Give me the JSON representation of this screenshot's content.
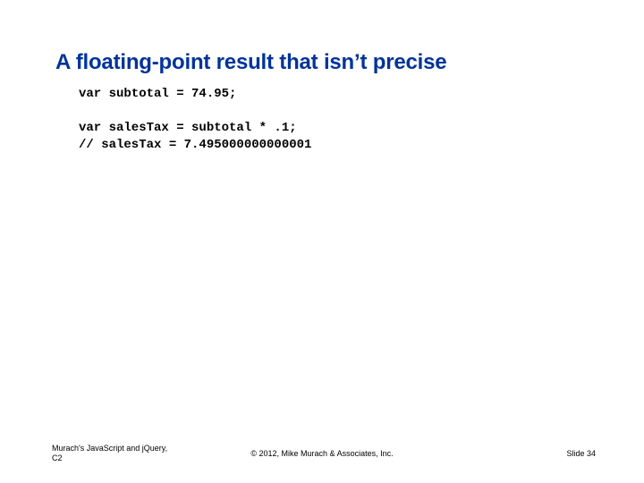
{
  "title": "A floating-point result that isn’t precise",
  "code": {
    "line1": "var subtotal = 74.95;",
    "blank1": "",
    "line2": "var salesTax = subtotal * .1;",
    "line3": "// salesTax = 7.495000000000001"
  },
  "footer": {
    "left_line1": "Murach's JavaScript and jQuery,",
    "left_line2": "C2",
    "center": "© 2012, Mike Murach & Associates, Inc.",
    "right": "Slide 34"
  }
}
